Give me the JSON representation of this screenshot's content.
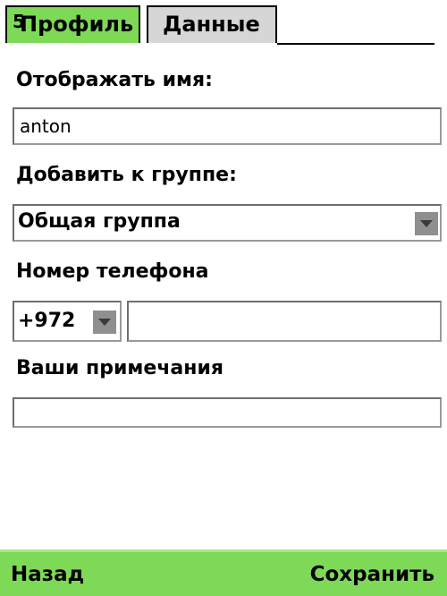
{
  "tabs": [
    {
      "label": "Профиль",
      "active": true
    },
    {
      "label": "Данные",
      "active": false
    }
  ],
  "tab_marker": "5",
  "form": {
    "display_name_label": "Отображать имя:",
    "display_name_value": "anton",
    "group_label": "Добавить к группе:",
    "group_value": "Общая группа",
    "phone_label": "Номер телефона",
    "phone_code": "+972",
    "phone_number": "",
    "notes_label": "Ваши примечания",
    "notes_value": ""
  },
  "softkeys": {
    "left": "Назад",
    "right": "Сохранить"
  },
  "colors": {
    "accent": "#7ed957",
    "tab_inactive": "#d6d6d6",
    "dropdown_button": "#8f8f8f"
  },
  "icons": [
    "dropdown-arrow-icon"
  ]
}
